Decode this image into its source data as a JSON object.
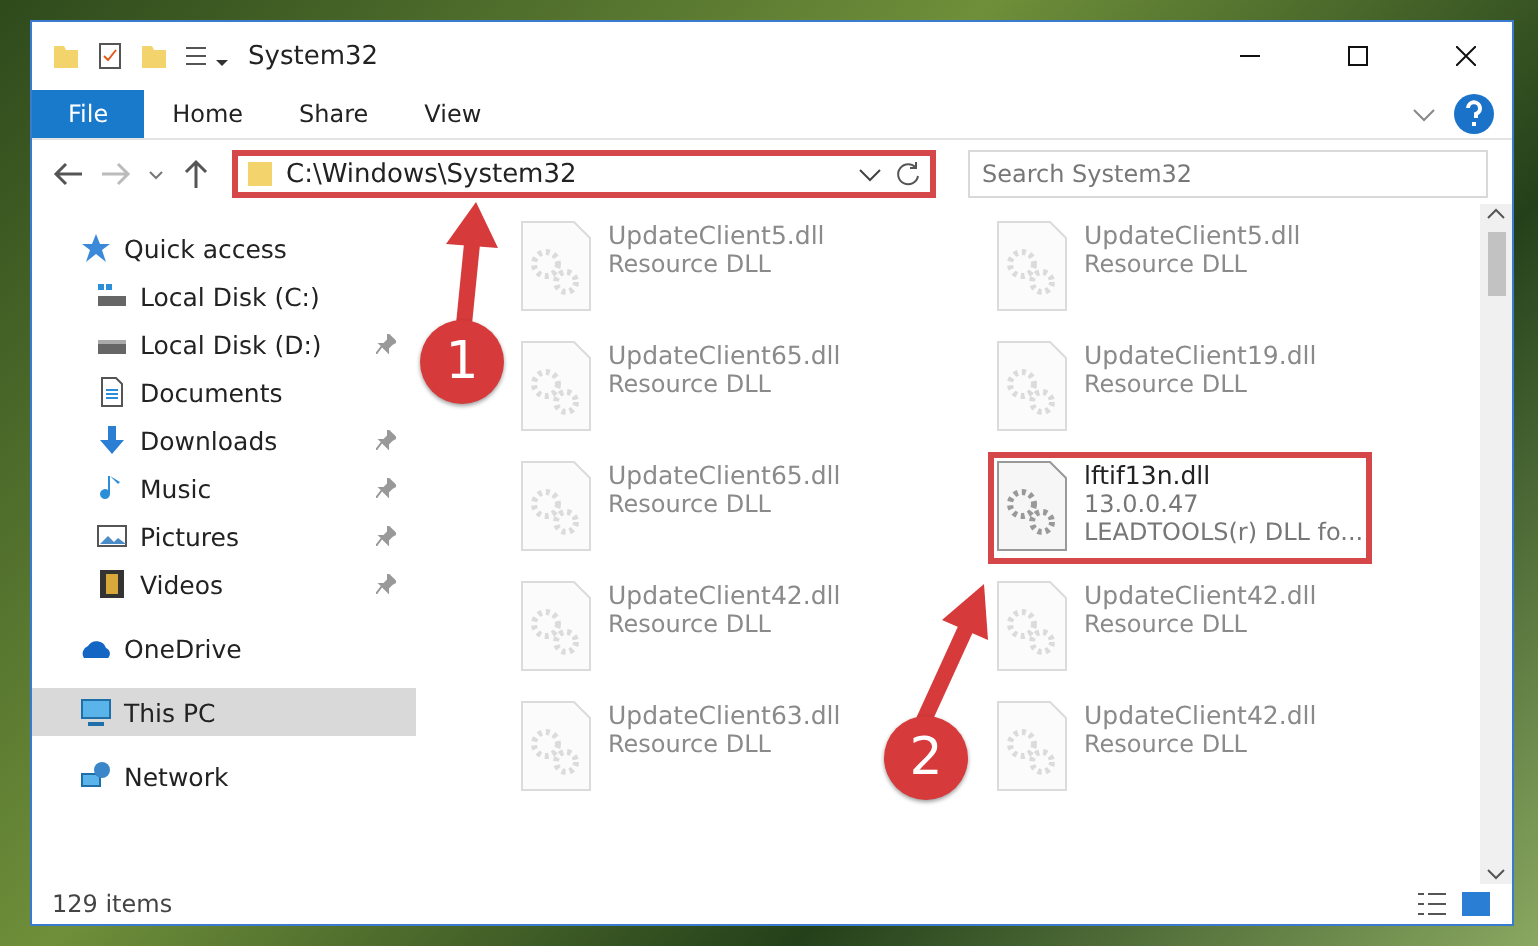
{
  "window": {
    "title": "System32"
  },
  "ribbon_tabs": [
    {
      "label": "File",
      "kind": "file"
    },
    {
      "label": "Home",
      "kind": "plain"
    },
    {
      "label": "Share",
      "kind": "plain"
    },
    {
      "label": "View",
      "kind": "plain"
    }
  ],
  "address_bar": {
    "path": "C:\\Windows\\System32",
    "highlighted": true
  },
  "search": {
    "placeholder": "Search System32"
  },
  "sidebar": {
    "items": [
      {
        "label": "Quick access",
        "selected": false,
        "children": [
          {
            "label": "Local Disk (C:)",
            "selected": false,
            "pinned": false
          },
          {
            "label": "Local Disk (D:)",
            "selected": false,
            "pinned": true
          },
          {
            "label": "Documents",
            "selected": false,
            "pinned": false
          },
          {
            "label": "Downloads",
            "selected": false,
            "pinned": true
          },
          {
            "label": "Music",
            "selected": false,
            "pinned": true
          },
          {
            "label": "Pictures",
            "selected": false,
            "pinned": true
          },
          {
            "label": "Videos",
            "selected": false,
            "pinned": true
          }
        ]
      },
      {
        "label": "OneDrive",
        "selected": false
      },
      {
        "label": "This PC",
        "selected": true
      },
      {
        "label": "Network",
        "selected": false
      }
    ]
  },
  "files": [
    {
      "name": "UpdateClient5.dll",
      "details": [
        "Resource DLL"
      ],
      "kind": "faded"
    },
    {
      "name": "UpdateClient5.dll",
      "details": [
        "Resource DLL"
      ],
      "kind": "faded"
    },
    {
      "name": "UpdateClient65.dll",
      "details": [
        "Resource DLL"
      ],
      "kind": "faded"
    },
    {
      "name": "UpdateClient19.dll",
      "details": [
        "Resource DLL"
      ],
      "kind": "faded"
    },
    {
      "name": "UpdateClient65.dll",
      "details": [
        "Resource DLL"
      ],
      "kind": "faded"
    },
    {
      "name": "lftif13n.dll",
      "details": [
        "13.0.0.47",
        "LEADTOOLS(r) DLL fo..."
      ],
      "kind": "highlighted"
    },
    {
      "name": "UpdateClient42.dll",
      "details": [
        "Resource DLL"
      ],
      "kind": "faded"
    },
    {
      "name": "UpdateClient42.dll",
      "details": [
        "Resource DLL"
      ],
      "kind": "faded"
    },
    {
      "name": "UpdateClient63.dll",
      "details": [
        "Resource DLL"
      ],
      "kind": "faded"
    },
    {
      "name": "UpdateClient42.dll",
      "details": [
        "Resource DLL"
      ],
      "kind": "faded"
    }
  ],
  "status_bar": {
    "item_count": "129 items"
  },
  "annotations": [
    {
      "number": "1"
    },
    {
      "number": "2"
    }
  ]
}
